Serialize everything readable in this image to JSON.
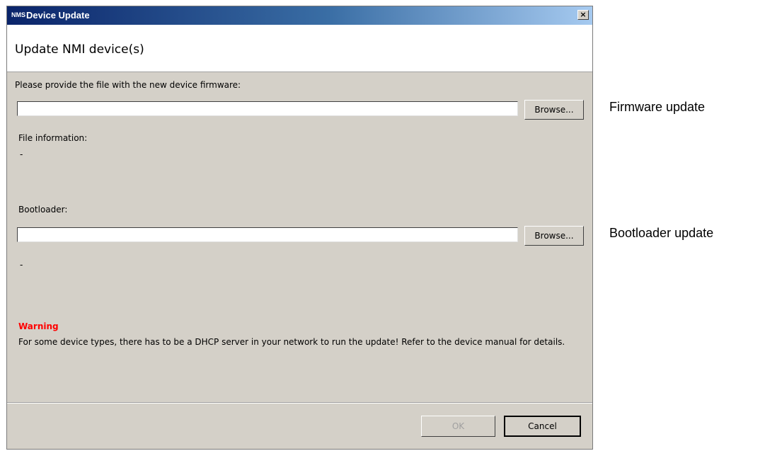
{
  "window": {
    "logo_text": "NMS",
    "title": "Device Update",
    "close_label": "×"
  },
  "header": {
    "title": "Update NMI device(s)"
  },
  "firmware": {
    "prompt": "Please provide the file with the new device firmware:",
    "path_value": "",
    "browse_label": "Browse...",
    "file_info_label": "File information:",
    "file_info_value": "-"
  },
  "bootloader": {
    "label": "Bootloader:",
    "path_value": "",
    "browse_label": "Browse...",
    "info_value": "-"
  },
  "warning": {
    "title": "Warning",
    "text": "For some device types, there has to be a DHCP server in your network to run the update! Refer to the device manual for details."
  },
  "footer": {
    "ok_label": "OK",
    "cancel_label": "Cancel"
  },
  "annotations": {
    "firmware": "Firmware update",
    "bootloader": "Bootloader update"
  }
}
